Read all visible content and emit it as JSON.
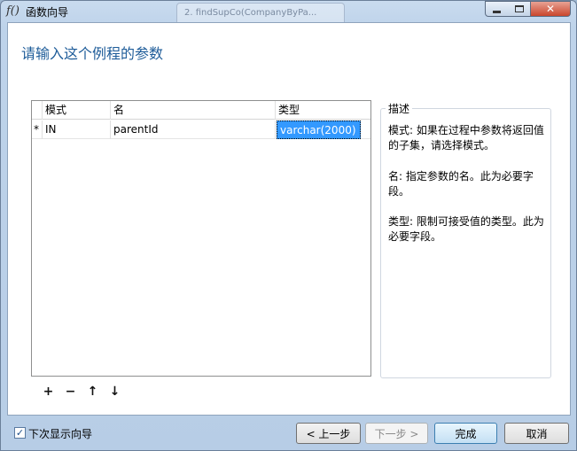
{
  "window": {
    "app_icon": "f()",
    "title": "函数向导",
    "background_tab": "2. findSupCo(CompanyByPa..."
  },
  "heading": "请输入这个例程的参数",
  "grid": {
    "columns": [
      "模式",
      "名",
      "类型"
    ],
    "rows": [
      {
        "indicator": "*",
        "mode": "IN",
        "name": "parentId",
        "type": "varchar(2000)"
      }
    ]
  },
  "toolbar": {
    "add_icon": "plus-icon",
    "remove_icon": "minus-icon",
    "up_icon": "arrow-up-icon",
    "down_icon": "arrow-down-icon"
  },
  "description": {
    "legend": "描述",
    "mode": "模式: 如果在过程中参数将返回值的子集，请选择模式。",
    "name": "名: 指定参数的名。此为必要字段。",
    "type": "类型: 限制可接受值的类型。此为必要字段。"
  },
  "footer": {
    "show_wizard_label": "下次显示向导",
    "show_wizard_checked": true,
    "prev": "< 上一步",
    "next": "下一步 >",
    "finish": "完成",
    "cancel": "取消"
  },
  "colors": {
    "heading": "#1e5c99",
    "selection": "#3399ff",
    "close_button": "#c9462c"
  }
}
